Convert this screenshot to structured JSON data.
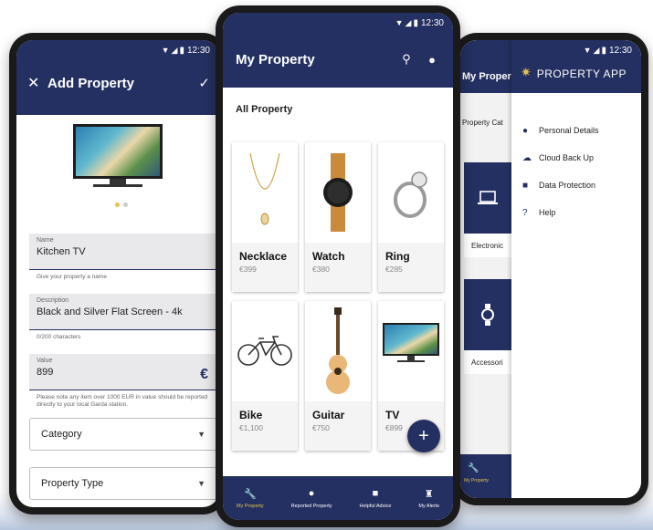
{
  "status_time": "12:30",
  "left": {
    "title": "Add Property",
    "name_label": "Name",
    "name_value": "Kitchen TV",
    "name_hint": "Give your property a name",
    "desc_label": "Description",
    "desc_value": "Black and Silver Flat Screen - 4k",
    "desc_hint": "0/200 characters",
    "value_label": "Value",
    "value_value": "899",
    "currency": "€",
    "value_hint": "Please note any item over 1000 EUR in value should be reported directly to your local Garda station.",
    "category": "Category",
    "property_type": "Property Type"
  },
  "middle": {
    "title": "My Property",
    "section": "All Property",
    "cards": [
      {
        "name": "Necklace",
        "price": "€399"
      },
      {
        "name": "Watch",
        "price": "€380"
      },
      {
        "name": "Ring",
        "price": "€285"
      },
      {
        "name": "Bike",
        "price": "€1,100"
      },
      {
        "name": "Guitar",
        "price": "€750"
      },
      {
        "name": "TV",
        "price": "€899"
      }
    ],
    "fab": "+",
    "nav": [
      {
        "label": "My Property"
      },
      {
        "label": "Reported Property"
      },
      {
        "label": "Helpful Advice"
      },
      {
        "label": "My Alerts"
      }
    ]
  },
  "right": {
    "behind_title": "My Proper",
    "category_label": "Property Cat",
    "tile1": "Electronic",
    "tile2": "Accessori",
    "nav_label": "My Property",
    "app_name": "PROPERTY APP",
    "menu": [
      {
        "label": "Personal Details"
      },
      {
        "label": "Cloud Back Up"
      },
      {
        "label": "Data Protection"
      },
      {
        "label": "Help"
      }
    ]
  },
  "colors": {
    "primary": "#243061",
    "accent": "#e7c349"
  }
}
